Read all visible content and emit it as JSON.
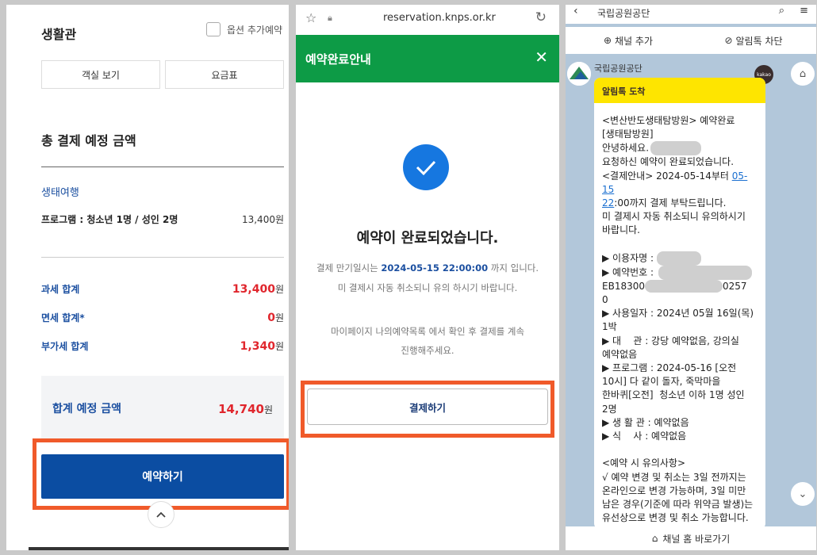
{
  "left_panel": {
    "title": "생활관",
    "option_label": "옵션 추가예약",
    "view_rooms_button": "객실 보기",
    "rate_table_button": "요금표",
    "total_heading": "총 결제 예정 금액",
    "category": "생태여행",
    "program_label": "프로그램 : 청소년 1명 / 성인 2명",
    "program_amount": "13,400원",
    "taxable_label": "과세 합계",
    "taxable_amount": "13,400",
    "exempt_label": "면세 합계*",
    "exempt_amount": "0",
    "vat_label": "부가세 합계",
    "vat_amount": "1,340",
    "won": "원",
    "grand_total_label": "합계 예정 금액",
    "grand_total_amount": "14,740",
    "reserve_button": "예약하기",
    "scroll_top_icon": "chevron-up-icon"
  },
  "middle_panel": {
    "url": "reservation.knps.or.kr",
    "header_title": "예약완료안내",
    "close_icon": "close-icon",
    "complete_message": "예약이 완료되었습니다.",
    "due_prefix": "결제 만기일시는 ",
    "due_datetime": "2024-05-15 22:00:00",
    "due_suffix": " 까지 입니다.",
    "cancel_notice": "미 결제시 자동 취소되니 유의 하시기 바랍니다.",
    "mypage_line1": "마이페이지 나의예약목록 에서 확인 후 결제를 계속",
    "mypage_line2": "진행해주세요.",
    "pay_button": "결제하기",
    "colors": {
      "header": "#0d9b46",
      "check": "#1677e0",
      "highlight": "#f05a2a"
    }
  },
  "right_panel": {
    "chat_name": "국립공원공단",
    "add_channel": "채널 추가",
    "block_alimtalk": "알림톡 차단",
    "sender": "국립공원공단",
    "kakao_badge": "kakao",
    "alimtalk_header": "알림톡 도착",
    "msg_1": "<변산반도생태탐방원> 예약완료\n[생태탐방원]\n안녕하세요.",
    "msg_2": "\n요청하신 예약이 완료되었습니다.\n<결제안내> 2024-05-14부터 ",
    "msg_link_1": "05-15",
    "msg_link_2": "22",
    "msg_3": ":00까지 결제 부탁드립니다.\n미 결제시 자동 취소되니 유의하시기\n바랍니다.\n\n▶ 이용자명 : ",
    "msg_4": "\n▶ 예약번호 :",
    "msg_5": "\nEB18300",
    "msg_6": "0257\n0\n▶ 사용일자 : 2024년 05월 16일(목)\n1박\n▶ 대    관 : 강당 예약없음, 강의실\n예약없음\n▶ 프로그램 : 2024-05-16 [오전\n10시] 다 같이 돌자, 죽막마을\n한바퀴[오전]  청소년 이하 1명 성인\n2명\n▶ 생 활 관 : 예약없음\n▶ 식    사 : 예약없음\n\n<예약 시 유의사항>\n√ 예약 변경 및 취소는 3일 전까지는\n온라인으로 변경 가능하며, 3일 미만\n남은 경우(기준에 따라 위약금 발생)는\n유선상으로 변경 및 취소 가능합니다.",
    "footer": "채널 홈 바로가기",
    "colors": {
      "bg": "#b2c7da",
      "alimtalk": "#fee500"
    }
  }
}
